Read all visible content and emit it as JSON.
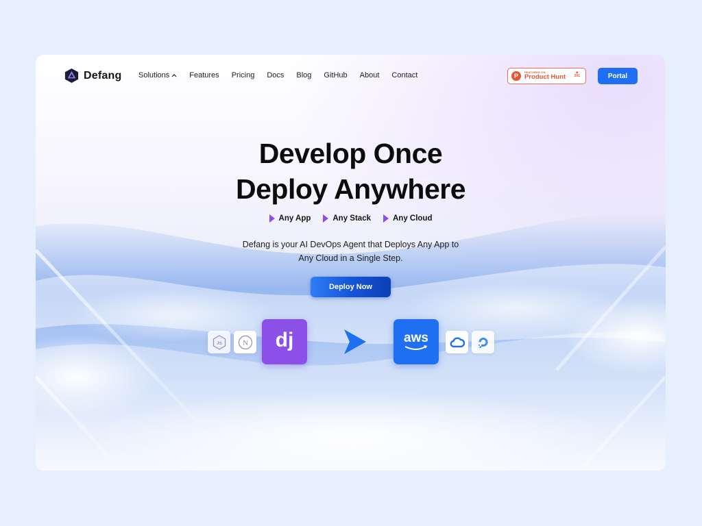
{
  "brand": {
    "name": "Defang"
  },
  "nav": {
    "items": [
      {
        "label": "Solutions",
        "has_dropdown": true
      },
      {
        "label": "Features"
      },
      {
        "label": "Pricing"
      },
      {
        "label": "Docs"
      },
      {
        "label": "Blog"
      },
      {
        "label": "GitHub"
      },
      {
        "label": "About"
      },
      {
        "label": "Contact"
      }
    ],
    "product_hunt": {
      "small_text": "FEATURED ON",
      "big_text": "Product Hunt",
      "count": "201"
    },
    "portal_label": "Portal"
  },
  "hero": {
    "title_line1": "Develop Once",
    "title_line2": "Deploy Anywhere",
    "tags": [
      "Any App",
      "Any Stack",
      "Any Cloud"
    ],
    "subtitle": "Defang is your AI DevOps Agent that Deploys Any App to Any Cloud in a Single Step.",
    "cta_label": "Deploy Now"
  },
  "logos": {
    "left": [
      "nodejs-icon",
      "nextjs-icon",
      "django-icon"
    ],
    "right": [
      "aws-icon",
      "google-cloud-icon",
      "digitalocean-icon"
    ],
    "django_text": "dj",
    "aws_text": "aws",
    "next_text": "N",
    "js_text": "JS"
  },
  "colors": {
    "accent": "#1f6ff2",
    "tag_arrow": "#8a4df0",
    "django": "#8c4fe8",
    "aws": "#1f6ff2",
    "product_hunt": "#e25834"
  }
}
